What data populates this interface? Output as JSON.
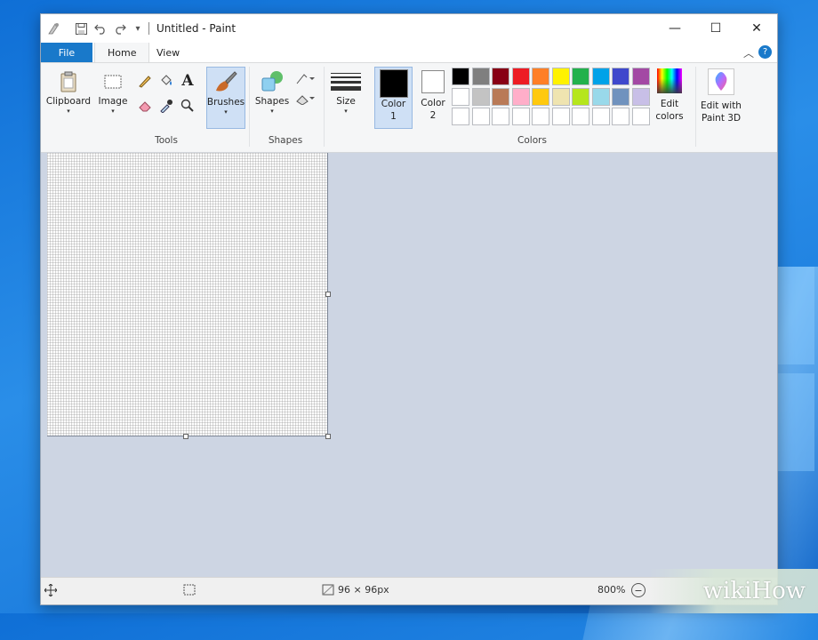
{
  "titlebar": {
    "title": "Untitled - Paint",
    "minimize_symbol": "—",
    "maximize_symbol": "☐",
    "close_symbol": "✕",
    "quick_access_more": "▾"
  },
  "tabs": {
    "file": "File",
    "home": "Home",
    "view": "View",
    "help_symbol": "?",
    "collapse_symbol": "︿"
  },
  "ribbon": {
    "clipboard": "Clipboard",
    "image": "Image",
    "brushes": "Brushes",
    "shapes_btn": "Shapes",
    "size": "Size",
    "color1_line1": "Color",
    "color1_line2": "1",
    "color2_line1": "Color",
    "color2_line2": "2",
    "edit_colors_line1": "Edit",
    "edit_colors_line2": "colors",
    "edit_3d_line1": "Edit with",
    "edit_3d_line2": "Paint 3D",
    "group_tools": "Tools",
    "group_shapes": "Shapes",
    "group_colors": "Colors",
    "text_tool": "A",
    "caret": "▾"
  },
  "colors": {
    "color1": "#000000",
    "color2": "#ffffff",
    "palette_row1": [
      "#000000",
      "#7f7f7f",
      "#880015",
      "#ed1c24",
      "#ff7f27",
      "#fff200",
      "#22b14c",
      "#00a2e8",
      "#3f48cc",
      "#a349a4"
    ],
    "palette_row2": [
      "#ffffff",
      "#c3c3c3",
      "#b97a57",
      "#ffaec9",
      "#ffc90e",
      "#efe4b0",
      "#b5e61d",
      "#99d9ea",
      "#7092be",
      "#c8bfe7"
    ],
    "palette_row3": [
      "#ffffff",
      "#ffffff",
      "#ffffff",
      "#ffffff",
      "#ffffff",
      "#ffffff",
      "#ffffff",
      "#ffffff",
      "#ffffff",
      "#ffffff"
    ]
  },
  "status": {
    "move_icon": "move-icon",
    "image_size": "96 × 96px",
    "zoom": "800%",
    "zoom_out_symbol": "−"
  },
  "watermark": "wikiHow"
}
